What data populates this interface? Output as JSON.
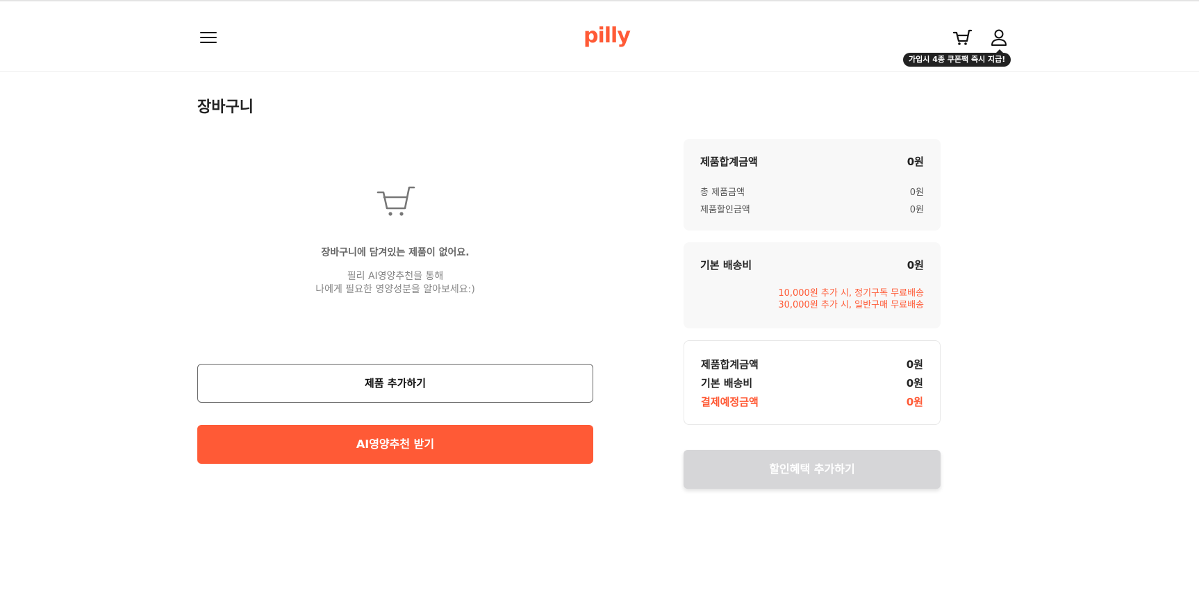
{
  "header": {
    "logo_text": "pilly",
    "tooltip": "가입시 4종 쿠폰팩 즉시 지급!",
    "icons": [
      "menu-icon",
      "cart-icon",
      "user-icon"
    ]
  },
  "page": {
    "title": "장바구니"
  },
  "empty_state": {
    "icon": "cart-icon",
    "title": "장바구니에 담겨있는 제품이 없어요.",
    "desc_line1": "필리 AI영양추천을 통해",
    "desc_line2": "나에게 필요한 영양성분을 알아보세요:)"
  },
  "buttons": {
    "add_product": "제품 추가하기",
    "ai_recommend": "AI영양추천 받기",
    "add_discount": "할인혜택 추가하기"
  },
  "summary": {
    "product_total": {
      "label": "제품합계금액",
      "value": "0원"
    },
    "total_product_amount": {
      "label": "총 제품금액",
      "value": "0원"
    },
    "product_discount": {
      "label": "제품할인금액",
      "value": "0원"
    }
  },
  "shipping": {
    "label": "기본 배송비",
    "value": "0원",
    "note1": "10,000원 추가 시, 정기구독 무료배송",
    "note2": "30,000원 추가 시, 일반구매 무료배송"
  },
  "final": {
    "product_total": {
      "label": "제품합계금액",
      "value": "0원"
    },
    "shipping": {
      "label": "기본 배송비",
      "value": "0원"
    },
    "payment": {
      "label": "결제예정금액",
      "value": "0원"
    }
  },
  "colors": {
    "accent": "#ff5a36",
    "disabled": "#d6d6d8"
  }
}
